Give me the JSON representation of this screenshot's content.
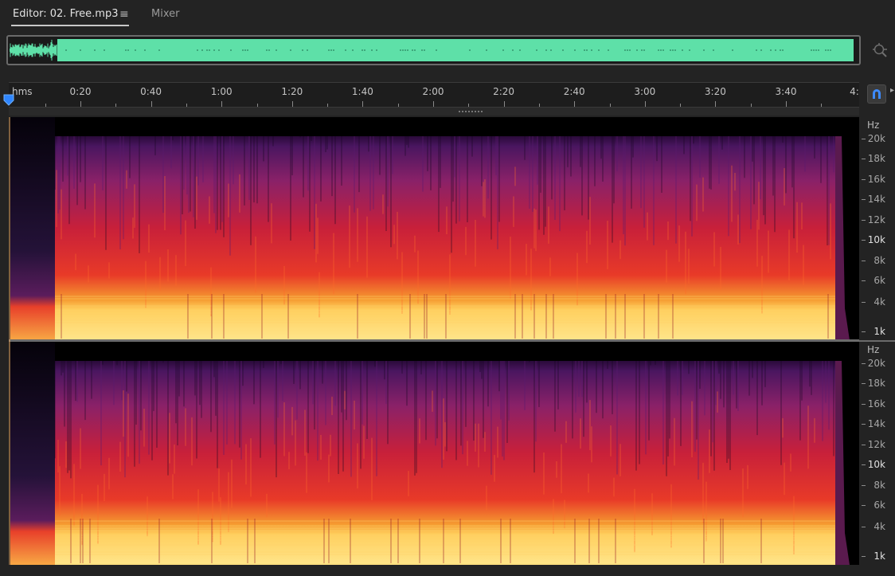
{
  "tabs": [
    {
      "label": "Editor: 02. Free.mp3",
      "active": true
    },
    {
      "label": "Mixer",
      "active": false
    }
  ],
  "menu_glyph": "≡",
  "overview": {
    "wave_color": "#5ee0a8"
  },
  "ruler": {
    "unit_label": "hms",
    "labels": [
      "0:20",
      "0:40",
      "1:00",
      "1:20",
      "1:40",
      "2:00",
      "2:20",
      "2:40",
      "3:00",
      "3:20",
      "3:40",
      "4:"
    ]
  },
  "hz_scale": {
    "unit": "Hz",
    "labels": [
      "20k",
      "18k",
      "16k",
      "14k",
      "12k",
      "10k",
      "8k",
      "6k",
      "4k",
      "1k"
    ],
    "strong": [
      "10k",
      "1k"
    ]
  },
  "icons": {
    "zoom": "zoom-magnifier-icon",
    "snap": "magnet-snap-icon",
    "playhead": "playhead-marker-icon",
    "menu": "hamburger-menu-icon"
  },
  "colors": {
    "background": "#232323",
    "spectrogram_low": "#ffd86a",
    "spectrogram_mid": "#e8202a",
    "spectrogram_high": "#5a1a6e",
    "accent": "#2f86ff"
  }
}
